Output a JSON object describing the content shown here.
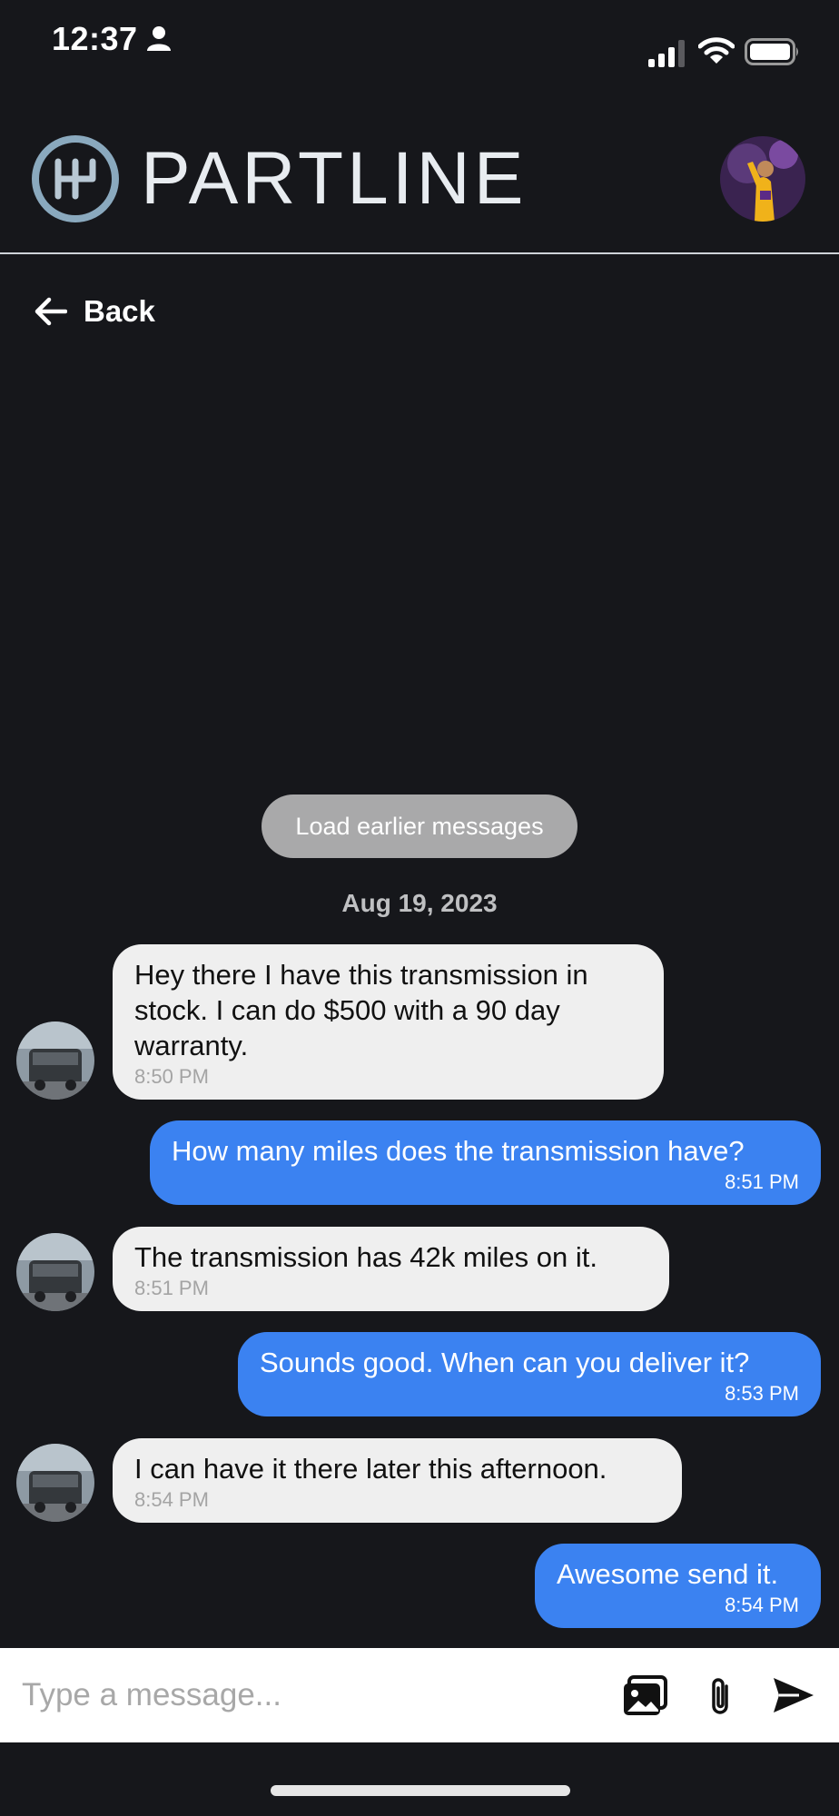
{
  "status_bar": {
    "time": "12:37"
  },
  "header": {
    "brand": "PARTLINE"
  },
  "nav": {
    "back_label": "Back"
  },
  "thread": {
    "load_earlier_label": "Load earlier messages",
    "date": "Aug 19, 2023",
    "messages": [
      {
        "direction": "in",
        "text": "Hey there I have this transmission in stock. I can do $500 with a 90 day warranty.",
        "time": "8:50 PM"
      },
      {
        "direction": "out",
        "text": "How many miles does the transmission have?",
        "time": "8:51 PM"
      },
      {
        "direction": "in",
        "text": "The transmission has 42k miles on it.",
        "time": "8:51 PM"
      },
      {
        "direction": "out",
        "text": "Sounds good. When can you deliver it?",
        "time": "8:53 PM"
      },
      {
        "direction": "in",
        "text": "I can have it there later this afternoon.",
        "time": "8:54 PM"
      },
      {
        "direction": "out",
        "text": "Awesome send it.",
        "time": "8:54 PM"
      }
    ]
  },
  "composer": {
    "placeholder": "Type a message..."
  },
  "colors": {
    "background": "#16171b",
    "outgoing_bubble": "#3b82f1",
    "incoming_bubble": "#efefef",
    "load_button": "#a9a9aa"
  }
}
